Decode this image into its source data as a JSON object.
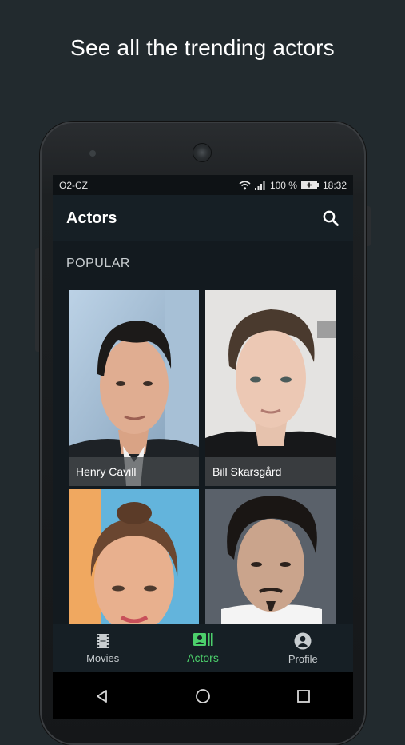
{
  "promo": {
    "headline": "See all the trending actors"
  },
  "status_bar": {
    "carrier": "O2-CZ",
    "battery": "100 %",
    "time": "18:32"
  },
  "app_bar": {
    "title": "Actors",
    "search_icon": "search-icon"
  },
  "section": {
    "label": "POPULAR"
  },
  "actors": [
    {
      "name": "Henry Cavill"
    },
    {
      "name": "Bill Skarsgård"
    },
    {
      "name": ""
    },
    {
      "name": ""
    }
  ],
  "bottom_nav": {
    "items": [
      {
        "label": "Movies",
        "icon": "film-icon",
        "active": false
      },
      {
        "label": "Actors",
        "icon": "actor-card-icon",
        "active": true
      },
      {
        "label": "Profile",
        "icon": "profile-icon",
        "active": false
      }
    ]
  },
  "colors": {
    "accent": "#4ccf6b",
    "app_bar": "#161f25",
    "background": "#131a1f"
  }
}
